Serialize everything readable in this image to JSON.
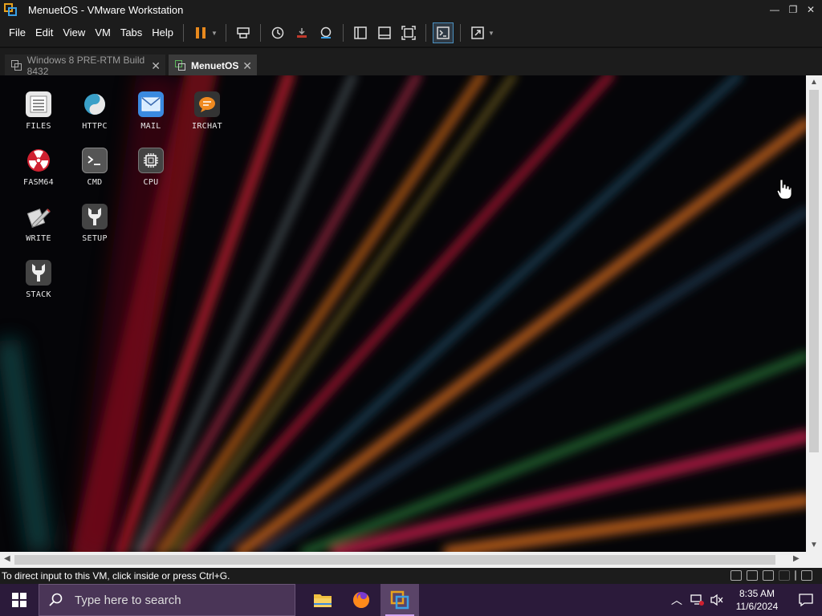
{
  "window": {
    "title": "MenuetOS - VMware Workstation",
    "controls": [
      "—",
      "❐",
      "✕"
    ]
  },
  "menu": {
    "items": [
      "File",
      "Edit",
      "View",
      "VM",
      "Tabs",
      "Help"
    ]
  },
  "tabs": [
    {
      "label": "Windows 8 PRE-RTM Build 8432",
      "active": false
    },
    {
      "label": "MenuetOS",
      "active": true
    }
  ],
  "desktop": {
    "icons": [
      {
        "label": "FILES",
        "icon": "files-icon"
      },
      {
        "label": "HTTPC",
        "icon": "yin-yang-icon"
      },
      {
        "label": "MAIL",
        "icon": "mail-icon"
      },
      {
        "label": "IRCHAT",
        "icon": "chat-bubble-icon"
      },
      {
        "label": "FASM64",
        "icon": "radiation-icon"
      },
      {
        "label": "CMD",
        "icon": "terminal-icon"
      },
      {
        "label": "CPU",
        "icon": "chip-icon"
      },
      {
        "label": "WRITE",
        "icon": "pencil-icon"
      },
      {
        "label": "SETUP",
        "icon": "wrench-icon"
      },
      {
        "label": "STACK",
        "icon": "wrench-icon"
      }
    ]
  },
  "status": {
    "text": "To direct input to this VM, click inside or press Ctrl+G."
  },
  "taskbar": {
    "search_placeholder": "Type here to search",
    "time": "8:35 AM",
    "date": "11/6/2024"
  },
  "colors": {
    "accent": "#e8891d",
    "taskbar": "#2b1a3a"
  }
}
